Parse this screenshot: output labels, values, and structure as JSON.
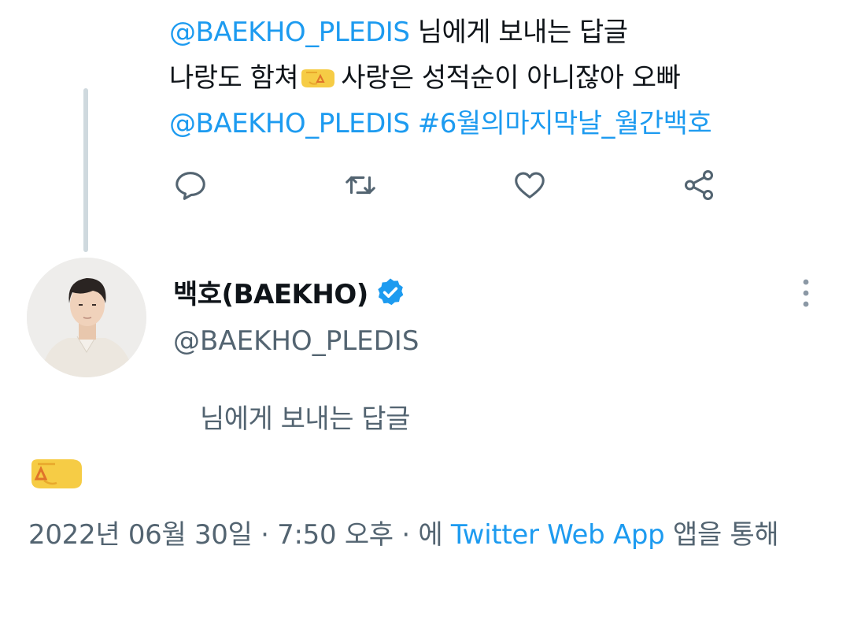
{
  "parent_tweet": {
    "replying_mention": "@BAEKHO_PLEDIS",
    "replying_suffix": "님에게 보내는 답글",
    "text_before_emoji": "나랑도 함쳐",
    "emoji": "left-facing-fist",
    "text_after_emoji": "사랑은 성적순이 아니잖아 오빠",
    "tag_mention": "@BAEKHO_PLEDIS",
    "hashtag": "#6월의마지막날_월간백호"
  },
  "actions": {
    "reply": "reply-icon",
    "retweet": "retweet-icon",
    "like": "heart-icon",
    "share": "share-icon"
  },
  "main_tweet": {
    "display_name": "백호(BAEKHO)",
    "handle": "@BAEKHO_PLEDIS",
    "replying_to": "님에게 보내는 답글",
    "body_emoji": "left-facing-fist",
    "date": "2022년 06월 30일",
    "separator": "·",
    "time": "7:50 오후",
    "separator2": "·",
    "via_prefix": "에",
    "source": "Twitter Web App",
    "via_suffix": "앱을 통해"
  },
  "colors": {
    "accent": "#1d9bf0",
    "muted": "#536471",
    "text": "#0f1419",
    "thread_line": "#cfd9de"
  }
}
